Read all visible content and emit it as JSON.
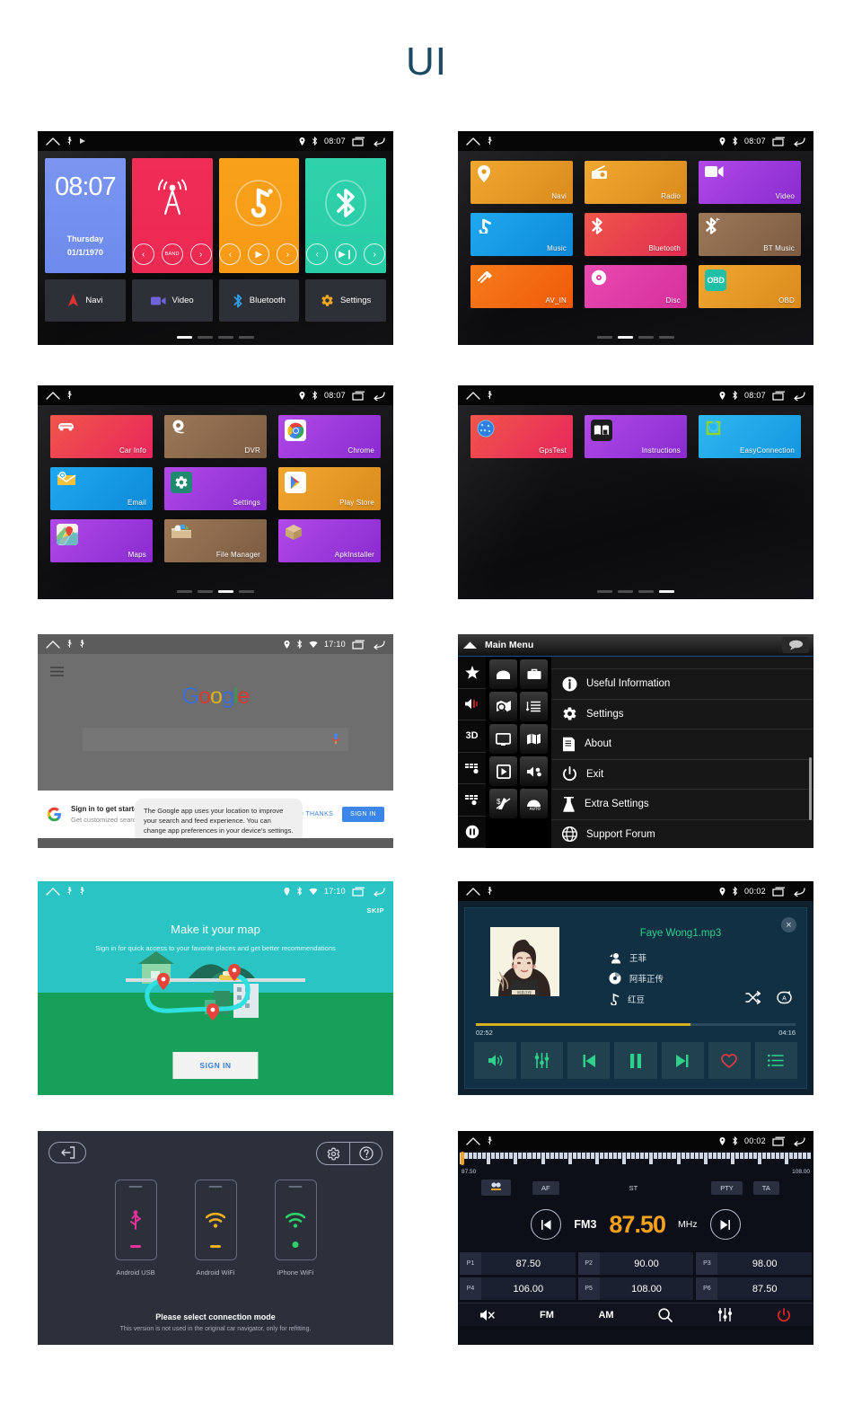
{
  "page": {
    "title": "UI"
  },
  "statusbar": {
    "home_icon": "home-icon",
    "usb_icon": "usb-icon",
    "location_icon": "location-icon",
    "bluetooth_icon": "bluetooth-icon",
    "wifi_icon": "wifi-icon",
    "recents_icon": "recents-icon",
    "back_icon": "back-icon",
    "time_0807": "08:07",
    "time_1710": "17:10",
    "time_0002": "00:02"
  },
  "home_screen": {
    "clock": {
      "time": "08:07",
      "day": "Thursday",
      "date": "01/1/1970"
    },
    "radio_tile": {
      "icon": "radio-tower-icon",
      "prev": "‹",
      "band": "BAND",
      "next": "›"
    },
    "music_tile": {
      "icon": "music-note-icon",
      "prev": "‹",
      "play": "▶",
      "next": "›"
    },
    "bt_tile": {
      "icon": "bluetooth-icon",
      "prev": "‹",
      "playpause": "▶❙",
      "next": "›"
    },
    "dock": [
      {
        "label": "Navi",
        "icon": "navi-arrow-icon",
        "color": "#e0342f"
      },
      {
        "label": "Video",
        "icon": "video-camera-icon",
        "color": "#6f63d8"
      },
      {
        "label": "Bluetooth",
        "icon": "bluetooth-icon",
        "color": "#2f9de0"
      },
      {
        "label": "Settings",
        "icon": "gear-icon",
        "color": "#f0a81e"
      }
    ],
    "pager": {
      "count": 4,
      "active": 1
    }
  },
  "app_grid_page2": {
    "apps": [
      {
        "label": "Navi",
        "icon": "map-pin-icon",
        "c1": "#f0a830",
        "c2": "#d98a1c"
      },
      {
        "label": "Radio",
        "icon": "radio-icon",
        "c1": "#f0a830",
        "c2": "#d98a1c"
      },
      {
        "label": "Video",
        "icon": "video-camera-icon",
        "c1": "#a83ce8",
        "c2": "#8a2bd0"
      },
      {
        "label": "Music",
        "icon": "music-note-icon",
        "c1": "#1fa8f0",
        "c2": "#0d8ad8"
      },
      {
        "label": "Bluetooth",
        "icon": "bluetooth-icon",
        "c1": "#f0564a",
        "c2": "#e02d52"
      },
      {
        "label": "BT Music",
        "icon": "bt-music-icon",
        "c1": "#9c7858",
        "c2": "#7d5c42"
      },
      {
        "label": "AV_IN",
        "icon": "av-plug-icon",
        "c1": "#f57c1a",
        "c2": "#f05a0a"
      },
      {
        "label": "Disc",
        "icon": "disc-icon",
        "c1": "#e84ab0",
        "c2": "#d62f9c"
      },
      {
        "label": "OBD",
        "icon": "obd-icon",
        "c1": "#f0a830",
        "c2": "#d98a1c"
      }
    ],
    "pager": {
      "count": 4,
      "active": 2
    }
  },
  "app_grid_page3": {
    "apps": [
      {
        "label": "Car Info",
        "icon": "car-icon",
        "c1": "#f0564a",
        "c2": "#e8265c"
      },
      {
        "label": "DVR",
        "icon": "dashcam-icon",
        "c1": "#9c7858",
        "c2": "#7d5c42"
      },
      {
        "label": "Chrome",
        "icon": "chrome-icon",
        "c1": "#b04ae8",
        "c2": "#8a2bd0"
      },
      {
        "label": "Email",
        "icon": "email-icon",
        "c1": "#1fa8f0",
        "c2": "#0d8ad8"
      },
      {
        "label": "Settings",
        "icon": "gear-icon",
        "c1": "#b04ae8",
        "c2": "#8a2bd0"
      },
      {
        "label": "Play Store",
        "icon": "play-store-icon",
        "c1": "#f0a830",
        "c2": "#d98a1c"
      },
      {
        "label": "Maps",
        "icon": "maps-icon",
        "c1": "#b04ae8",
        "c2": "#8a2bd0"
      },
      {
        "label": "File Manager",
        "icon": "file-manager-icon",
        "c1": "#9c7858",
        "c2": "#7d5c42"
      },
      {
        "label": "ApkInstaller",
        "icon": "box-icon",
        "c1": "#b04ae8",
        "c2": "#8a2bd0"
      }
    ],
    "pager": {
      "count": 4,
      "active": 3
    }
  },
  "app_grid_page4": {
    "apps": [
      {
        "label": "GpsTest",
        "icon": "gps-globe-icon",
        "c1": "#f0564a",
        "c2": "#e8265c"
      },
      {
        "label": "Instructions",
        "icon": "book-icon",
        "c1": "#b04ae8",
        "c2": "#8a2bd0"
      },
      {
        "label": "EasyConnection",
        "icon": "easyconnection-icon",
        "c1": "#2fb8f0",
        "c2": "#1496e0"
      }
    ],
    "pager": {
      "count": 4,
      "active": 4
    }
  },
  "google_screen": {
    "menu_icon": "hamburger-icon",
    "logo_letters": [
      "G",
      "o",
      "o",
      "g",
      "l",
      "e"
    ],
    "search_placeholder": "",
    "mic_icon": "microphone-icon",
    "card": {
      "google_icon": "google-g-icon",
      "title": "Sign in to get started",
      "subtitle": "Get customized search results",
      "no_thanks": "NO THANKS",
      "sign_in": "SIGN IN"
    },
    "tooltip": "The Google app uses your location to improve your search and feed experience. You can change app preferences in your device's settings."
  },
  "main_menu": {
    "title": "Main Menu",
    "up_icon": "up-arrow-icon",
    "bubble_icon": "speech-bubble-icon",
    "rail": [
      {
        "icon": "star-icon",
        "label": ""
      },
      {
        "icon": "volume-mute-icon",
        "label": ""
      },
      {
        "icon": "3d-icon",
        "label": "3D"
      },
      {
        "icon": "route-settings-icon",
        "label": ""
      },
      {
        "icon": "route-alt-icon",
        "label": ""
      },
      {
        "icon": "pause-icon",
        "label": ""
      }
    ],
    "tiles": [
      "home-icon",
      "briefcase-icon",
      "find-on-map-icon",
      "route-list-icon",
      "monitor-icon",
      "map-icon",
      "play-icon",
      "media-icon",
      "no-toll-icon",
      "auto-icon"
    ],
    "items": [
      {
        "label": "Useful Information",
        "icon": "info-icon"
      },
      {
        "label": "Settings",
        "icon": "settings-gear-icon"
      },
      {
        "label": "About",
        "icon": "document-icon"
      },
      {
        "label": "Exit",
        "icon": "power-icon"
      },
      {
        "label": "Extra Settings",
        "icon": "flask-icon"
      },
      {
        "label": "Support Forum",
        "icon": "globe-icon"
      }
    ]
  },
  "maps_onboarding": {
    "skip": "SKIP",
    "headline": "Make it your map",
    "subtext": "Sign in for quick access to your favorite places and get better recommendations",
    "sign_in": "SIGN IN",
    "art_icon": "map-illustration"
  },
  "music_player": {
    "close_icon": "close-icon",
    "album_art": "faye-wong-album-art",
    "track_title": "Faye Wong1.mp3",
    "artist": {
      "icon": "artist-icon",
      "value": "王菲"
    },
    "album": {
      "icon": "album-disc-icon",
      "value": "阿菲正传"
    },
    "song": {
      "icon": "note-icon",
      "value": "红豆"
    },
    "shuffle_icon": "shuffle-icon",
    "repeat_icon": "repeat-all-icon",
    "elapsed": "02:52",
    "duration": "04:16",
    "progress_percent": 67,
    "buttons": [
      {
        "icon": "volume-icon"
      },
      {
        "icon": "equalizer-icon"
      },
      {
        "icon": "previous-icon"
      },
      {
        "icon": "pause-icon"
      },
      {
        "icon": "next-icon"
      },
      {
        "icon": "heart-icon"
      },
      {
        "icon": "playlist-icon"
      }
    ]
  },
  "connection_mode": {
    "back_icon": "exit-icon",
    "settings_icon": "gear-icon",
    "help_icon": "question-icon",
    "devices": [
      {
        "label": "Android USB",
        "icon": "usb-icon",
        "color": "#e8329b"
      },
      {
        "label": "Android WiFi",
        "icon": "wifi-icon",
        "color": "#f0b01e"
      },
      {
        "label": "iPhone WiFi",
        "icon": "wifi-icon",
        "color": "#2fd06a"
      }
    ],
    "footer_title": "Please select connection mode",
    "footer_note": "This version is not used in the original car navigator, only for refitting."
  },
  "radio": {
    "range_min": "87.50",
    "range_max": "108.00",
    "chips": [
      {
        "label": "",
        "icon": "loc-icon",
        "style": "box"
      },
      {
        "label": "AF",
        "icon": "",
        "style": "box"
      },
      {
        "label": "ST",
        "icon": "",
        "style": "flat"
      },
      {
        "label": "PTY",
        "icon": "",
        "style": "box"
      },
      {
        "label": "TA",
        "icon": "",
        "style": "box"
      }
    ],
    "prev_icon": "seek-prev-icon",
    "next_icon": "seek-next-icon",
    "band": "FM3",
    "frequency": "87.50",
    "unit": "MHz",
    "presets": [
      {
        "n": "P1",
        "v": "87.50"
      },
      {
        "n": "P2",
        "v": "90.00"
      },
      {
        "n": "P3",
        "v": "98.00"
      },
      {
        "n": "P4",
        "v": "106.00"
      },
      {
        "n": "P5",
        "v": "108.00"
      },
      {
        "n": "P6",
        "v": "87.50"
      }
    ],
    "toolbar": [
      {
        "label": "",
        "icon": "mute-icon"
      },
      {
        "label": "FM",
        "icon": ""
      },
      {
        "label": "AM",
        "icon": ""
      },
      {
        "label": "",
        "icon": "search-icon"
      },
      {
        "label": "",
        "icon": "equalizer-icon"
      },
      {
        "label": "",
        "icon": "power-icon"
      }
    ]
  }
}
